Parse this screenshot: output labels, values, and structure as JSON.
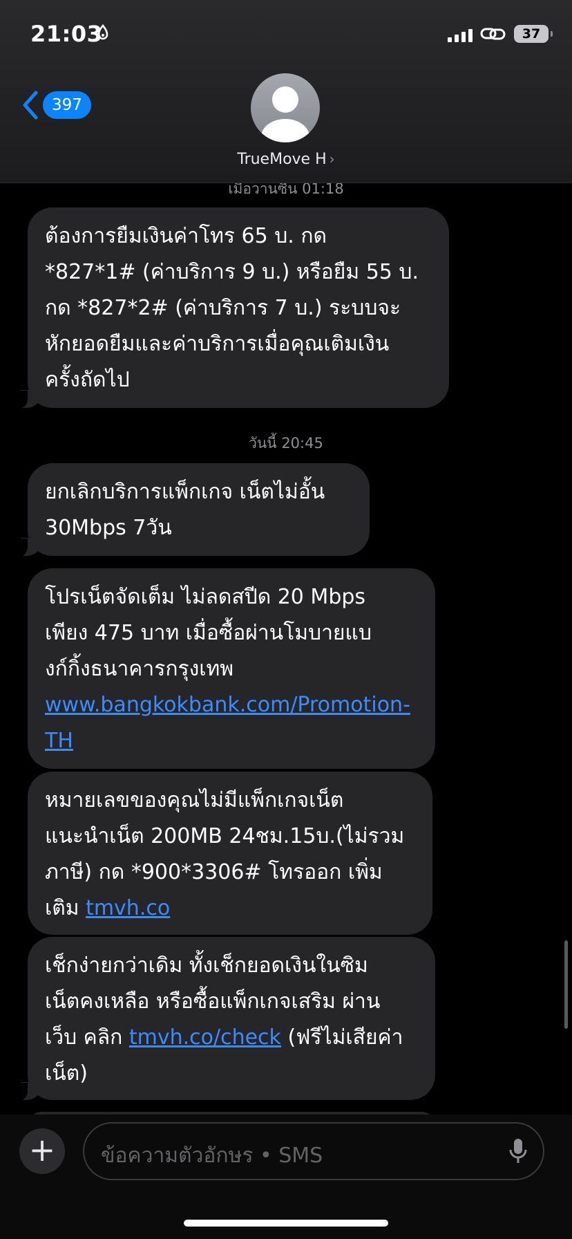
{
  "status_bar": {
    "time": "21:03",
    "battery": "37"
  },
  "header": {
    "back_count": "397",
    "contact_name": "TrueMove H",
    "contact_chevron": "›"
  },
  "messages": {
    "timestamp_old": "เมื่อวานซืน 01:18",
    "timestamp_today": "วันนี้ 20:45",
    "m1": "ต้องการยืมเงินค่าโทร 65 บ. กด\n*827*1# (ค่าบริการ 9 บ.) หรือยืม 55 บ.\nกด *827*2# (ค่าบริการ 7 บ.) ระบบจะ\nหักยอดยืมและค่าบริการเมื่อคุณเติมเงิน\nครั้งถัดไป",
    "m2": "ยกเลิกบริการแพ็กเกจ เน็ตไม่อั้น\n30Mbps 7วัน",
    "m3_text": "โปรเน็ตจัดเต็ม ไม่ลดสปีด 20 Mbps\nเพียง 475 บาท เมื่อซื้อผ่านโมบายแบ\nงก์กิ้งธนาคารกรุงเทพ\n",
    "m3_link": "www.bangkokbank.com/Promotion-\nTH",
    "m4_text": "หมายเลขของคุณไม่มีแพ็กเกจเน็ต\nแนะนำเน็ต 200MB 24ชม.15บ.(ไม่รวม\nภาษี) กด *900*3306# โทรออก เพิ่ม\nเติม ",
    "m4_link": "tmvh.co",
    "m5_text": "เช็กง่ายกว่าเดิม ทั้งเช็กยอดเงินในซิม\nเน็ตคงเหลือ หรือซื้อแพ็กเกจเสริม ผ่าน\nเว็บ คลิก ",
    "m5_link": "tmvh.co/check",
    "m5_tail": " (ฟรีไม่เสียค่า\nเน็ต)"
  },
  "composer": {
    "plus": "+",
    "placeholder": "ข้อความตัวอักษร • SMS"
  },
  "colors": {
    "accent": "#0a84ff",
    "bubble": "#262628",
    "link": "#3a8cff"
  },
  "icons": [
    "moon-icon",
    "signal-icon",
    "link-icon",
    "battery-icon",
    "back-chevron-icon",
    "avatar-icon",
    "plus-icon",
    "mic-icon"
  ]
}
